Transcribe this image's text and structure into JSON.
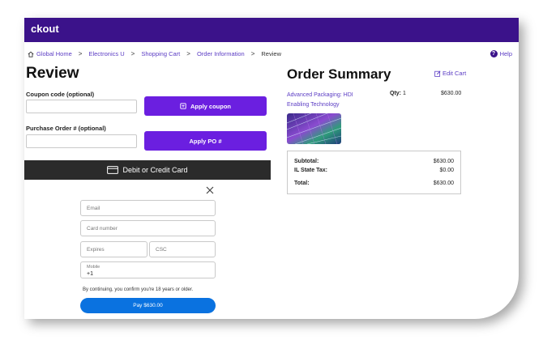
{
  "header": {
    "title": "ckout"
  },
  "breadcrumb": {
    "items": [
      "Global Home",
      "Electronics U",
      "Shopping Cart",
      "Order Information"
    ],
    "current": "Review",
    "separator": ">"
  },
  "help": {
    "label": "Help"
  },
  "review": {
    "title": "Review",
    "coupon_label": "Coupon code (optional)",
    "coupon_button": "Apply coupon",
    "po_label": "Purchase Order # (optional)",
    "po_button": "Apply PO #",
    "card_bar_label": "Debit or Credit Card"
  },
  "payment": {
    "email_placeholder": "Email",
    "card_number_placeholder": "Card number",
    "expires_placeholder": "Expires",
    "csc_placeholder": "CSC",
    "mobile_label": "Mobile",
    "mobile_prefix": "+1",
    "consent": "By continuing, you confirm you're 18 years or older.",
    "pay_button": "Pay $630.00"
  },
  "summary": {
    "title": "Order Summary",
    "edit_cart": "Edit Cart",
    "product": {
      "name": "Advanced Packaging: HDI Enabling Technology",
      "qty_label": "Qty:",
      "qty_value": "1",
      "price": "$630.00"
    },
    "subtotal_label": "Subtotal:",
    "subtotal_value": "$630.00",
    "tax_label": "IL State Tax:",
    "tax_value": "$0.00",
    "total_label": "Total:",
    "total_value": "$630.00"
  },
  "colors": {
    "header": "#3b128a",
    "accent": "#6b1fe0",
    "link": "#5b3cc4",
    "pay": "#0a72e0",
    "card_bar": "#2b2b2b"
  },
  "icons": [
    "home-icon",
    "help-icon",
    "coupon-icon",
    "card-icon",
    "close-icon",
    "edit-icon"
  ]
}
